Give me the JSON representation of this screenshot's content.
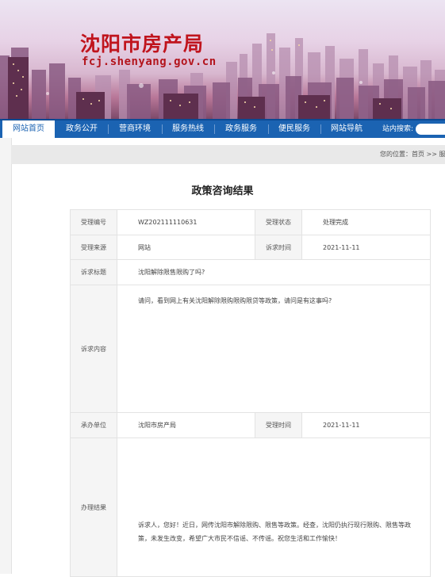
{
  "header": {
    "title": "沈阳市房产局",
    "url": "fcj.shenyang.gov.cn"
  },
  "nav": {
    "items": [
      "网站首页",
      "政务公开",
      "营商环境",
      "服务热线",
      "政务服务",
      "便民服务",
      "网站导航"
    ],
    "active_index": 0,
    "search_label": "站内搜索:",
    "search_value": ""
  },
  "breadcrumb": {
    "text": "您的位置：首页 >> 服务热线"
  },
  "page": {
    "title": "政策咨询结果"
  },
  "record": {
    "id_label": "受理编号",
    "id_value": "WZ202111110631",
    "status_label": "受理状态",
    "status_value": "处理完成",
    "source_label": "受理来源",
    "source_value": "网站",
    "submit_time_label": "诉求时间",
    "submit_time_value": "2021-11-11",
    "subject_label": "诉求标题",
    "subject_value": "沈阳解除限售限购了吗?",
    "content_label": "诉求内容",
    "content_value": "请问，看到网上有关沈阳解除限购限购限贷等政策，请问是有这事吗?",
    "dept_label": "承办单位",
    "dept_value": "沈阳市房产局",
    "accept_time_label": "受理时间",
    "accept_time_value": "2021-11-11",
    "result_label": "办理结果",
    "result_value": "诉求人，您好！近日，网传沈阳市解除限购、限售等政策。经查，沈阳仍执行现行限购、限售等政策，未发生改变，希望广大市民不信谣、不传谣。祝您生活和工作愉快！"
  },
  "colors": {
    "nav_blue": "#1b63b2",
    "logo_red": "#c0141d"
  }
}
